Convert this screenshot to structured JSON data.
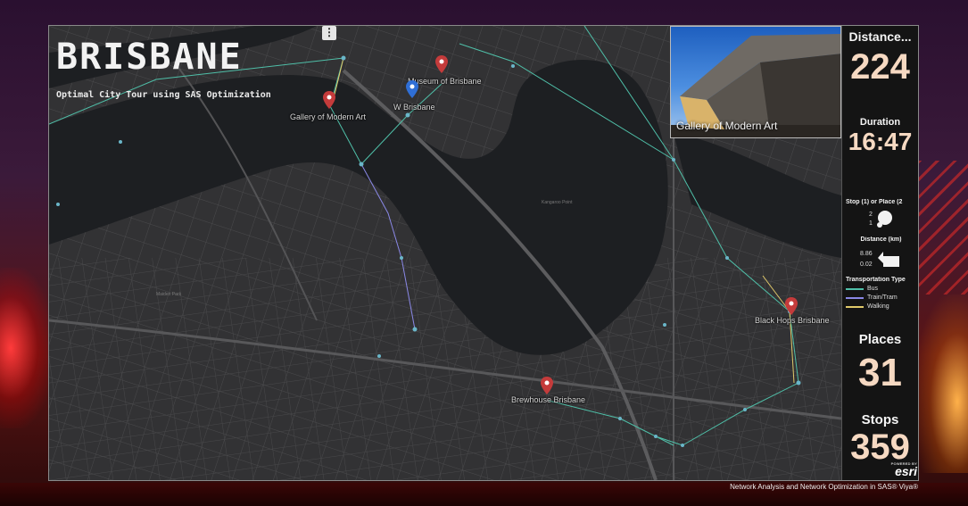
{
  "header": {
    "title": "BRISBANE",
    "subtitle": "Optimal City Tour using SAS Optimization",
    "menu_icon": "⋮"
  },
  "map": {
    "places": [
      {
        "name": "Museum of Brisbane",
        "color": "#c43b3b"
      },
      {
        "name": "W Brisbane",
        "color": "#2f6fd6"
      },
      {
        "name": "Gallery of Modern Art",
        "color": "#c43b3b"
      },
      {
        "name": "Black Hops Brisbane",
        "color": "#c43b3b"
      },
      {
        "name": "Brewhouse Brisbane",
        "color": "#c43b3b"
      }
    ],
    "district_labels": [
      "Maiden Park",
      "Kangaroo Point"
    ]
  },
  "photo": {
    "caption": "Gallery of Modern Art"
  },
  "panel": {
    "distance_title": "Distance...",
    "distance_value": "224",
    "duration_title": "Duration",
    "duration_value": "16:47",
    "legend_stop_title": "Stop (1) or Place (2",
    "legend_stop_values": [
      "2",
      "1"
    ],
    "legend_distance_title": "Distance (km)",
    "legend_distance_values": [
      "8.86",
      "0.02"
    ],
    "legend_transport_title": "Transportation Type",
    "transport_types": [
      {
        "label": "Bus",
        "color": "#4fbfa8"
      },
      {
        "label": "Train/Tram",
        "color": "#8a88e6"
      },
      {
        "label": "Walking",
        "color": "#e0c96a"
      }
    ],
    "places_title": "Places",
    "places_value": "31",
    "stops_title": "Stops",
    "stops_value": "359",
    "powered_by": "POWERED BY",
    "esri_logo": "esri"
  },
  "footer": {
    "text": "Network Analysis and Network Optimization in SAS® Viya®"
  }
}
